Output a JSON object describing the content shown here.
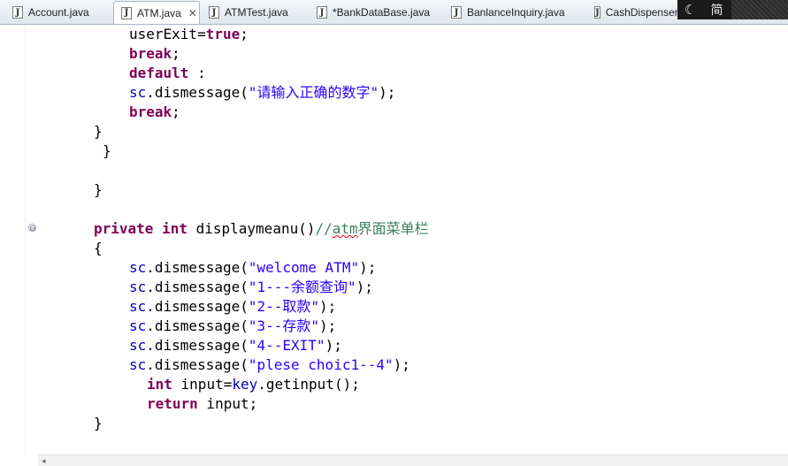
{
  "tabs": [
    {
      "label": "Account.java",
      "icon": "J",
      "active": false
    },
    {
      "label": "ATM.java",
      "icon": "J",
      "active": true,
      "close": "✕"
    },
    {
      "label": "ATMTest.java",
      "icon": "J",
      "active": false
    },
    {
      "label": "*BankDataBase.java",
      "icon": "J",
      "active": false
    },
    {
      "label": "BanlanceInquiry.java",
      "icon": "J",
      "active": false
    },
    {
      "label": "CashDispenser.j",
      "icon": "J",
      "active": false
    }
  ],
  "overlay": {
    "moon": "☾",
    "text": "简"
  },
  "code": {
    "l1_a": "userExit=",
    "l1_b": "true",
    "l1_c": ";",
    "l2": "break",
    "l2_s": ";",
    "l3": "default",
    "l3_s": " :",
    "l4_a": "sc",
    "l4_b": ".dismessage(",
    "l4_c": "\"请输入正确的数字\"",
    "l4_d": ");",
    "l5": "break",
    "l5_s": ";",
    "l6": "}",
    "l7": "}",
    "l8": "}",
    "l9_a": "private",
    "l9_b": "int",
    "l9_c": " displaymeanu()",
    "l9_d": "//",
    "l9_e": "atm",
    "l9_f": "界面菜单栏",
    "l10": "{",
    "l11_a": "sc",
    "l11_b": ".dismessage(",
    "l11_c": "\"welcome ATM\"",
    "l11_d": ");",
    "l12_a": "sc",
    "l12_b": ".dismessage(",
    "l12_c": "\"1---余额查询\"",
    "l12_d": ");",
    "l13_a": "sc",
    "l13_b": ".dismessage(",
    "l13_c": "\"2--取款\"",
    "l13_d": ");",
    "l14_a": "sc",
    "l14_b": ".dismessage(",
    "l14_c": "\"3--存款\"",
    "l14_d": ");",
    "l15_a": "sc",
    "l15_b": ".dismessage(",
    "l15_c": "\"4--EXIT\"",
    "l15_d": ");",
    "l16_a": "sc",
    "l16_b": ".dismessage(",
    "l16_c": "\"plese choic1--4\"",
    "l16_d": ");",
    "l17_a": "int",
    "l17_b": " input=",
    "l17_c": "key",
    "l17_d": ".getinput();",
    "l18_a": "return",
    "l18_b": " input;",
    "l19": "}"
  },
  "fold": "⊖",
  "scroll_arrow": "◂"
}
